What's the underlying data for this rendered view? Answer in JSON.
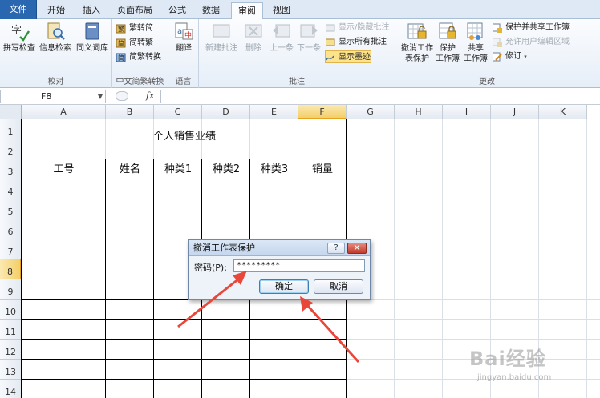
{
  "ribbon": {
    "tabs": [
      "文件",
      "开始",
      "插入",
      "页面布局",
      "公式",
      "数据",
      "审阅",
      "视图"
    ],
    "active_tab": "审阅",
    "groups": {
      "proofing": {
        "label": "校对",
        "spell": "拼写检查",
        "research": "信息检索",
        "thesaurus": "同义词库"
      },
      "chinese": {
        "label": "中文简繁转换",
        "to_trad": "繁转简",
        "to_simp": "简转繁",
        "convert": "简繁转换"
      },
      "language": {
        "label": "语言",
        "translate": "翻译"
      },
      "comments": {
        "label": "批注",
        "new": "新建批注",
        "delete": "删除",
        "prev": "上一条",
        "next": "下一条",
        "show_hide": "显示/隐藏批注",
        "show_all": "显示所有批注",
        "show_ink": "显示墨迹"
      },
      "changes": {
        "label": "更改",
        "unprotect_sheet": [
          "撤消工作",
          "表保护"
        ],
        "protect_book": [
          "保护",
          "工作簿"
        ],
        "share_book": [
          "共享",
          "工作簿"
        ],
        "protect_share": "保护并共享工作簿",
        "allow_edit": "允许用户编辑区域",
        "track": "修订"
      }
    }
  },
  "formula_bar": {
    "name_box": "F8",
    "fx": "fx",
    "value": ""
  },
  "grid": {
    "columns": [
      "A",
      "B",
      "C",
      "D",
      "E",
      "F",
      "G",
      "H",
      "I",
      "J",
      "K"
    ],
    "selected_column": "F",
    "rows": [
      "1",
      "2",
      "3",
      "4",
      "5",
      "6",
      "7",
      "8",
      "9",
      "10",
      "11",
      "12",
      "13",
      "14"
    ],
    "selected_row": "8",
    "title": "个人销售业绩",
    "headers": [
      "工号",
      "姓名",
      "种类1",
      "种类2",
      "种类3",
      "销量"
    ]
  },
  "dialog": {
    "title": "撤消工作表保护",
    "help": "?",
    "close": "✕",
    "password_label": "密码(P):",
    "password_value": "*********",
    "ok": "确定",
    "cancel": "取消"
  },
  "watermark": {
    "text": "Bai经验",
    "url": "jingyan.baidu.com"
  },
  "colors": {
    "file_tab": "#2a67b1",
    "selection": "#f4cf6a",
    "arrow": "#e8473a"
  }
}
